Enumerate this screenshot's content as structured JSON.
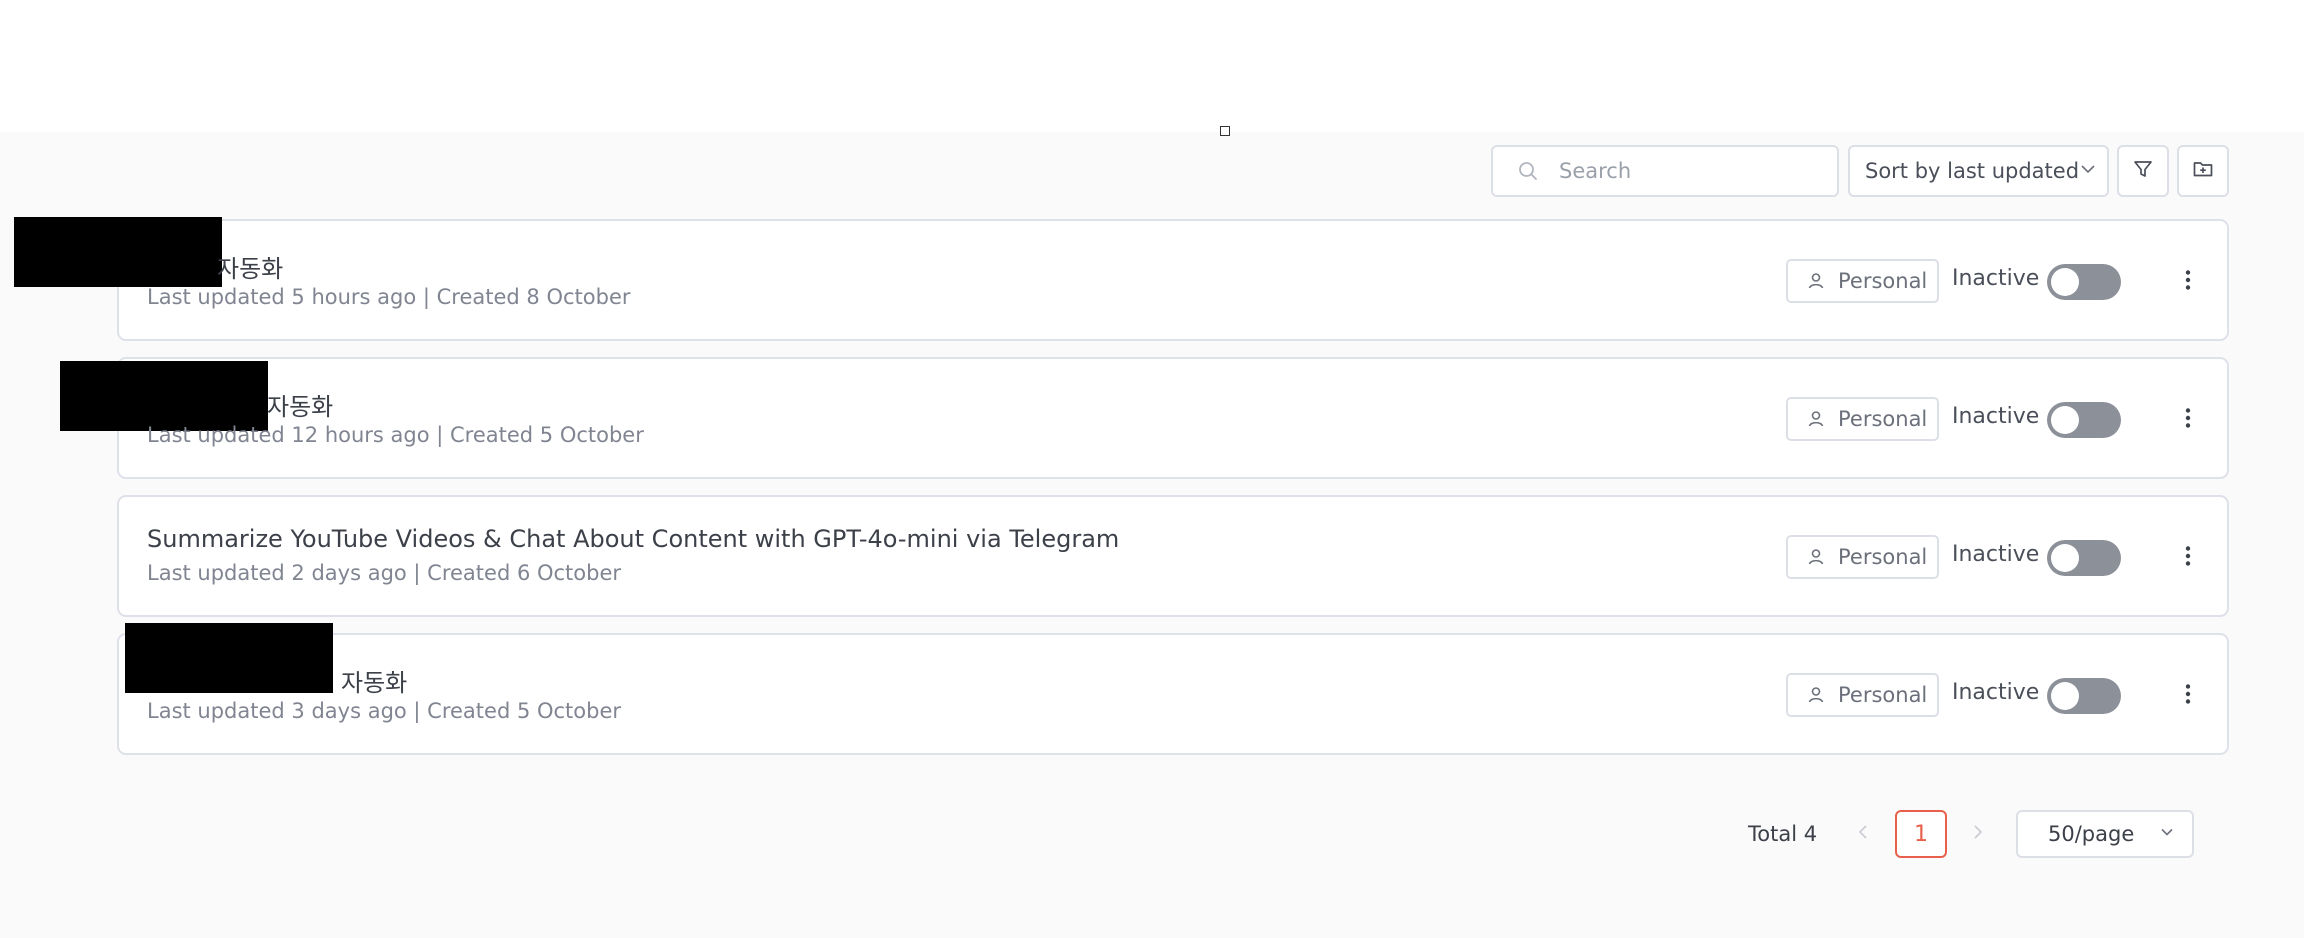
{
  "toolbar": {
    "search_placeholder": "Search",
    "sort_label": "Sort by last updated"
  },
  "workflows": [
    {
      "title": "자동화",
      "meta": "Last updated 5 hours ago | Created 8 October",
      "badge": "Personal",
      "status": "Inactive",
      "active": false
    },
    {
      "title": "자동화",
      "meta": "Last updated 12 hours ago | Created 5 October",
      "badge": "Personal",
      "status": "Inactive",
      "active": false
    },
    {
      "title": "Summarize YouTube Videos & Chat About Content with GPT-4o-mini via Telegram",
      "meta": "Last updated 2 days ago | Created 6 October",
      "badge": "Personal",
      "status": "Inactive",
      "active": false
    },
    {
      "title": "자동화",
      "meta": "Last updated 3 days ago | Created 5 October",
      "badge": "Personal",
      "status": "Inactive",
      "active": false
    }
  ],
  "pagination": {
    "total_label": "Total 4",
    "current_page": "1",
    "page_size": "50/page"
  },
  "colors": {
    "accent": "#e8604c",
    "toggle_off": "#8c9199",
    "border": "#dfe1ea"
  },
  "icons": [
    "search-icon",
    "chevron-down-icon",
    "filter-icon",
    "folder-plus-icon",
    "user-icon",
    "more-vertical-icon",
    "chevron-left-icon",
    "chevron-right-icon"
  ]
}
